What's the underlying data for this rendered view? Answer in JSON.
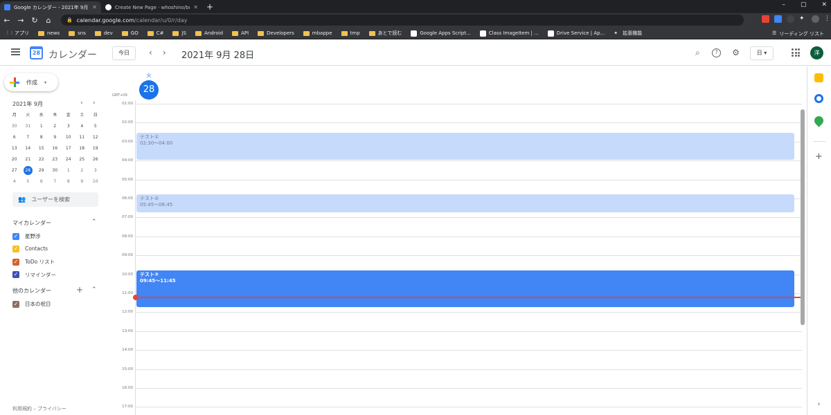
{
  "browser": {
    "tabs": [
      {
        "title": "Google カレンダー - 2021年 9月 28日",
        "close": "✕"
      },
      {
        "title": "Create New Page · whoshino/bro",
        "close": "✕"
      }
    ],
    "new_tab": "+",
    "window_controls": [
      "–",
      "▢",
      "✕"
    ],
    "url": {
      "domain": "calendar.google.com",
      "path": "/calendar/u/0/r/day"
    },
    "nav": {
      "back": "←",
      "forward": "→",
      "reload": "↻",
      "home": "⌂"
    },
    "bookmarks": [
      {
        "label": "アプリ",
        "icon": "apps-grid-icon"
      },
      {
        "label": "news",
        "icon": "folder-icon"
      },
      {
        "label": "sns",
        "icon": "folder-icon"
      },
      {
        "label": "dev",
        "icon": "folder-icon"
      },
      {
        "label": "GO",
        "icon": "folder-icon"
      },
      {
        "label": "C#",
        "icon": "folder-icon"
      },
      {
        "label": "JS",
        "icon": "folder-icon"
      },
      {
        "label": "Android",
        "icon": "folder-icon"
      },
      {
        "label": "API",
        "icon": "folder-icon"
      },
      {
        "label": "Developers",
        "icon": "folder-icon"
      },
      {
        "label": "mbappe",
        "icon": "folder-icon"
      },
      {
        "label": "tmp",
        "icon": "folder-icon"
      },
      {
        "label": "あとで読む",
        "icon": "folder-icon"
      },
      {
        "label": "Google Apps Script...",
        "icon": "page-icon"
      },
      {
        "label": "Class ImageItem | ...",
        "icon": "page-icon"
      },
      {
        "label": "Drive Service | Ap...",
        "icon": "page-icon"
      },
      {
        "label": "拡張機能",
        "icon": "puzzle-icon"
      }
    ],
    "reading_list": "リーディング リスト"
  },
  "header": {
    "app_name": "カレンダー",
    "logo_day": "28",
    "today_button": "今日",
    "prev": "‹",
    "next": "›",
    "date_title": "2021年 9月 28日",
    "view_select": "日 ▾",
    "avatar": "洋"
  },
  "sidebar": {
    "create": "作成",
    "create_caret": "▾",
    "mini_title": "2021年 9月",
    "mini_prev": "‹",
    "mini_next": "›",
    "weekdays": [
      "月",
      "火",
      "水",
      "木",
      "金",
      "土",
      "日"
    ],
    "weeks": [
      [
        "30",
        "31",
        "1",
        "2",
        "3",
        "4",
        "5"
      ],
      [
        "6",
        "7",
        "8",
        "9",
        "10",
        "11",
        "12"
      ],
      [
        "13",
        "14",
        "15",
        "16",
        "17",
        "18",
        "19"
      ],
      [
        "20",
        "21",
        "22",
        "23",
        "24",
        "25",
        "26"
      ],
      [
        "27",
        "28",
        "29",
        "30",
        "1",
        "2",
        "3"
      ],
      [
        "4",
        "5",
        "6",
        "7",
        "8",
        "9",
        "10"
      ]
    ],
    "selected_day": "28",
    "search_people": "ユーザーを検索",
    "my_calendars_title": "マイカレンダー",
    "my_calendars": [
      {
        "label": "星野涉",
        "color": "#4285f4"
      },
      {
        "label": "Contacts",
        "color": "#f6bf26"
      },
      {
        "label": "ToDo リスト",
        "color": "#d2632d"
      },
      {
        "label": "リマインダー",
        "color": "#3f51b5"
      }
    ],
    "other_calendars_title": "他のカレンダー",
    "other_calendars": [
      {
        "label": "日本の祝日",
        "color": "#8d6e63"
      }
    ],
    "footer": "利用規約 – プライバシー"
  },
  "day_view": {
    "day_of_week": "火",
    "day_number": "28",
    "timezone": "GMT+09",
    "hours": [
      "01:00",
      "02:00",
      "03:00",
      "04:00",
      "05:00",
      "06:00",
      "07:00",
      "08:00",
      "09:00",
      "10:00",
      "11:00",
      "12:00",
      "13:00",
      "14:00",
      "15:00",
      "16:00",
      "17:00"
    ],
    "events": [
      {
        "title": "テスト①",
        "time": "02:30～04:00",
        "start": 2.5,
        "end": 4.0,
        "style": "light"
      },
      {
        "title": "テスト②",
        "time": "05:45～06:45",
        "start": 5.75,
        "end": 6.75,
        "style": "light"
      },
      {
        "title": "テスト③",
        "time": "09:45～11:45",
        "start": 9.75,
        "end": 11.75,
        "style": "dark"
      }
    ],
    "current_time": 11.2
  },
  "colors": {
    "accent": "#1a73e8",
    "event_light": "#c6dafc",
    "event_dark": "#4285f4",
    "now_line": "#ea4335"
  }
}
